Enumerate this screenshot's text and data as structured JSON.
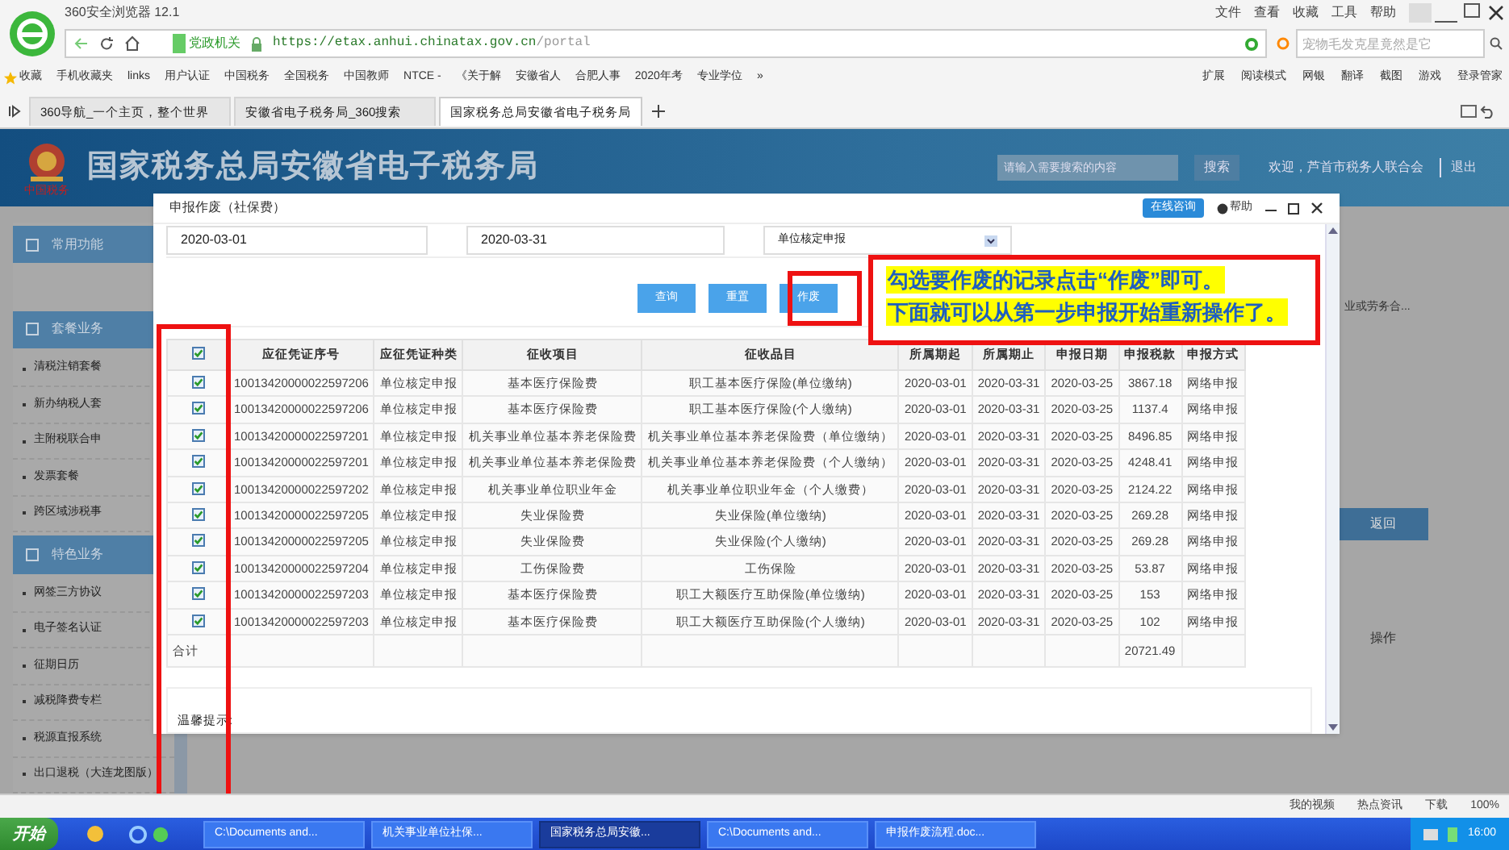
{
  "browser": {
    "title": "360安全浏览器 12.1",
    "menu": [
      "文件",
      "查看",
      "收藏",
      "工具",
      "帮助"
    ],
    "site_badge": "党政机关",
    "url_host": "https://etax.anhui.chinatax.gov.cn",
    "url_path": "/portal",
    "search": {
      "placeholder": "宠物毛发克星竟然是它"
    },
    "bookmarks": [
      "收藏",
      "手机收藏夹",
      "links",
      "用户认证",
      "中国税务",
      "全国税务",
      "中国教师",
      "NTCE -",
      "《关于解",
      "安徽省人",
      "合肥人事",
      "2020年考",
      "专业学位",
      "»"
    ],
    "tools": [
      "扩展",
      "阅读模式",
      "网银",
      "翻译",
      "截图",
      "游戏",
      "登录管家"
    ],
    "tabs": [
      {
        "label": "360导航_一个主页，整个世界",
        "selected": false
      },
      {
        "label": "安徽省电子税务局_360搜索",
        "selected": false
      },
      {
        "label": "国家税务总局安徽省电子税务局",
        "selected": true
      }
    ]
  },
  "site": {
    "title": "国家税务总局安徽省电子税务局",
    "emblem_caption": "中国税务",
    "search_placeholder": "请输入需要搜索的内容",
    "search_button": "搜索",
    "welcome": "欢迎，芦首市税务人联合会",
    "logout": "退出"
  },
  "sidebar": [
    {
      "kind": "header",
      "label": "常用功能"
    },
    {
      "kind": "blank"
    },
    {
      "kind": "header",
      "label": "套餐业务"
    },
    {
      "kind": "item",
      "label": "清税注销套餐"
    },
    {
      "kind": "item",
      "label": "新办纳税人套"
    },
    {
      "kind": "item",
      "label": "主附税联合申"
    },
    {
      "kind": "item",
      "label": "发票套餐"
    },
    {
      "kind": "item",
      "label": "跨区域涉税事"
    },
    {
      "kind": "header",
      "label": "特色业务"
    },
    {
      "kind": "item",
      "label": "网签三方协议"
    },
    {
      "kind": "item",
      "label": "电子签名认证"
    },
    {
      "kind": "item",
      "label": "征期日历"
    },
    {
      "kind": "item",
      "label": "减税降费专栏"
    },
    {
      "kind": "item",
      "label": "税源直报系统"
    },
    {
      "kind": "item",
      "label": "出口退税（大连龙图版）"
    }
  ],
  "background_panel": {
    "text": "业或劳务合...",
    "return_button": "返回",
    "column": "操作"
  },
  "dialog": {
    "title": "申报作废（社保费）",
    "consult_button": "在线咨询",
    "help_button": "帮助",
    "fields": [
      "2020-03-01",
      "2020-03-31"
    ],
    "select": "单位核定申报",
    "buttons": [
      "查询",
      "重置",
      "作废"
    ],
    "table": {
      "header_checked": true,
      "columns": [
        "应征凭证序号",
        "应征凭证种类",
        "征收项目",
        "征收品目",
        "所属期起",
        "所属期止",
        "申报日期",
        "申报税款",
        "申报方式"
      ],
      "rows": [
        {
          "checked": true,
          "cells": [
            "10013420000022597206",
            "单位核定申报",
            "基本医疗保险费",
            "职工基本医疗保险(单位缴纳)",
            "2020-03-01",
            "2020-03-31",
            "2020-03-25",
            "3867.18",
            "网络申报"
          ]
        },
        {
          "checked": true,
          "cells": [
            "10013420000022597206",
            "单位核定申报",
            "基本医疗保险费",
            "职工基本医疗保险(个人缴纳)",
            "2020-03-01",
            "2020-03-31",
            "2020-03-25",
            "1137.4",
            "网络申报"
          ]
        },
        {
          "checked": true,
          "cells": [
            "10013420000022597201",
            "单位核定申报",
            "机关事业单位基本养老保险费",
            "机关事业单位基本养老保险费（单位缴纳）",
            "2020-03-01",
            "2020-03-31",
            "2020-03-25",
            "8496.85",
            "网络申报"
          ]
        },
        {
          "checked": true,
          "cells": [
            "10013420000022597201",
            "单位核定申报",
            "机关事业单位基本养老保险费",
            "机关事业单位基本养老保险费（个人缴纳）",
            "2020-03-01",
            "2020-03-31",
            "2020-03-25",
            "4248.41",
            "网络申报"
          ]
        },
        {
          "checked": true,
          "cells": [
            "10013420000022597202",
            "单位核定申报",
            "机关事业单位职业年金",
            "机关事业单位职业年金（个人缴费）",
            "2020-03-01",
            "2020-03-31",
            "2020-03-25",
            "2124.22",
            "网络申报"
          ]
        },
        {
          "checked": true,
          "cells": [
            "10013420000022597205",
            "单位核定申报",
            "失业保险费",
            "失业保险(单位缴纳)",
            "2020-03-01",
            "2020-03-31",
            "2020-03-25",
            "269.28",
            "网络申报"
          ]
        },
        {
          "checked": true,
          "cells": [
            "10013420000022597205",
            "单位核定申报",
            "失业保险费",
            "失业保险(个人缴纳)",
            "2020-03-01",
            "2020-03-31",
            "2020-03-25",
            "269.28",
            "网络申报"
          ]
        },
        {
          "checked": true,
          "cells": [
            "10013420000022597204",
            "单位核定申报",
            "工伤保险费",
            "工伤保险",
            "2020-03-01",
            "2020-03-31",
            "2020-03-25",
            "53.87",
            "网络申报"
          ]
        },
        {
          "checked": true,
          "cells": [
            "10013420000022597203",
            "单位核定申报",
            "基本医疗保险费",
            "职工大额医疗互助保险(单位缴纳)",
            "2020-03-01",
            "2020-03-31",
            "2020-03-25",
            "153",
            "网络申报"
          ]
        },
        {
          "checked": true,
          "cells": [
            "10013420000022597203",
            "单位核定申报",
            "基本医疗保险费",
            "职工大额医疗互助保险(个人缴纳)",
            "2020-03-01",
            "2020-03-31",
            "2020-03-25",
            "102",
            "网络申报"
          ]
        }
      ],
      "total_label": "合计",
      "total_value": "20721.49"
    },
    "tip": "温馨提示:"
  },
  "callout": [
    "勾选要作废的记录点击“作废”即可。",
    "下面就可以从第一步申报开始重新操作了。"
  ],
  "status_bar": [
    "我的视频",
    "热点资讯",
    "下载",
    "100%"
  ],
  "taskbar": {
    "start": "开始",
    "tasks": [
      {
        "label": "C:\\Documents and...",
        "selected": false
      },
      {
        "label": "机关事业单位社保...",
        "selected": false
      },
      {
        "label": "国家税务总局安徽...",
        "selected": true
      },
      {
        "label": "C:\\Documents and...",
        "selected": false
      },
      {
        "label": "申报作废流程.doc...",
        "selected": false
      }
    ],
    "clock": "16:00"
  }
}
